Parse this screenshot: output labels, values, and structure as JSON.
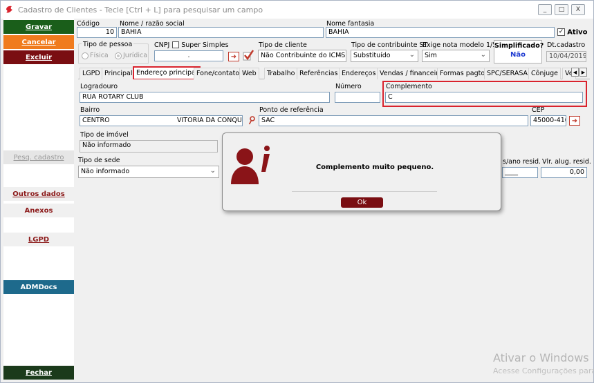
{
  "window": {
    "title": "Cadastro de Clientes - Tecle [Ctrl + L] para pesquisar um campo",
    "controls": [
      "_",
      "□",
      "X"
    ]
  },
  "sidebar": {
    "gravar": "Gravar",
    "cancelar": "Cancelar",
    "excluir": "Excluir",
    "pesq": "Pesq. cadastro",
    "outros": "Outros dados",
    "anexos": "Anexos",
    "lgpd": "LGPD",
    "admdocs": "ADMDocs",
    "fechar": "Fechar"
  },
  "header": {
    "codigo_label": "Código",
    "codigo_value": "10",
    "nome_label": "Nome / razão social",
    "nome_value": "BAHIA",
    "fantasia_label": "Nome fantasia",
    "fantasia_value": "BAHIA",
    "ativo_label": "Ativo",
    "ativo_checked": "✓",
    "tipo_pessoa_label": "Tipo de pessoa",
    "fisica_label": "Física",
    "juridica_label": "Jurídica",
    "cnpj_label": "CNPJ",
    "super_simples_label": "Super Simples",
    "cnpj_value": ".",
    "tipo_cliente_label": "Tipo de cliente",
    "tipo_cliente_value": "Não Contribuinte do ICMS",
    "tipo_contrib_st_label": "Tipo de contribuinte ST",
    "tipo_contrib_st_value": "Substituído",
    "exige_nota_label": "Exige nota modelo 1/55",
    "exige_nota_value": "Sim",
    "simplificado_label": "Simplificado?",
    "simplificado_value": "Não",
    "dt_cadastro_label": "Dt.cadastro",
    "dt_cadastro_value": "10/04/2019"
  },
  "tabs": [
    "LGPD",
    "Principal",
    "Endereço principal",
    "Fone/contato",
    "Web",
    "Trabalho",
    "Referências",
    "Endereços",
    "Vendas / financeiro",
    "Formas pagto",
    "SPC/SERASA",
    "Cônjuge",
    "Ve"
  ],
  "address": {
    "logradouro_label": "Logradouro",
    "logradouro_value": "RUA ROTARY CLUB",
    "numero_label": "Número",
    "numero_value": "",
    "complemento_label": "Complemento",
    "complemento_value": "C",
    "bairro_label": "Bairro",
    "bairro_value": "CENTRO",
    "cidade_value": "VITORIA DA CONQUIS",
    "ponto_ref_label": "Ponto de referência",
    "ponto_ref_value": "SAC",
    "cep_label": "CEP",
    "cep_value": "45000-410",
    "tipo_imovel_label": "Tipo de imóvel",
    "tipo_imovel_value": "Não informado",
    "tipo_sede_label": "Tipo de sede",
    "tipo_sede_value": "Não informado",
    "ano_resid_label": "s/ano resid.",
    "ano_resid_value": "____",
    "alug_resid_label": "Vlr. alug. resid.",
    "alug_resid_value": "0,00"
  },
  "dialog": {
    "message": "Complemento muito pequeno.",
    "ok_label": "Ok"
  },
  "watermark": {
    "line1": "Ativar o Windows",
    "line2": "Acesse Configurações para"
  },
  "colors": {
    "accent_red": "#d9232d",
    "gravar_green": "#1a5e1a",
    "cancelar_orange": "#f07b1e",
    "excluir_maroon": "#7a0e12",
    "admdocs_blue": "#1e6a8c"
  }
}
